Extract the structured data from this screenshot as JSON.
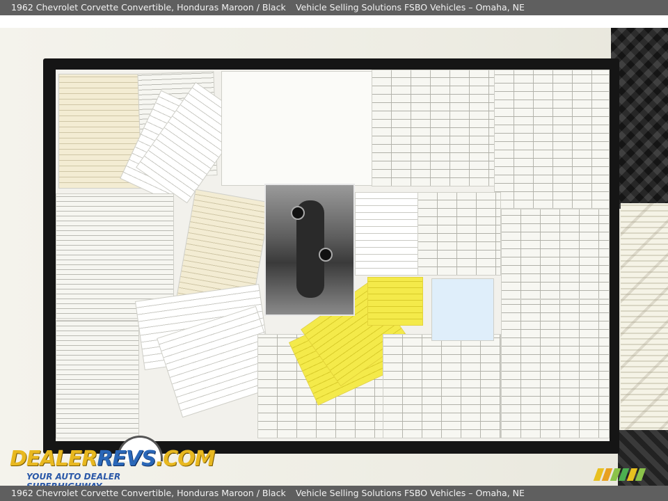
{
  "header": {
    "left": "1962 Chevrolet Corvette Convertible,  Honduras Maroon / Black",
    "right": "Vehicle Selling Solutions FSBO Vehicles – Omaha, NE"
  },
  "footer": {
    "left": "1962 Chevrolet Corvette Convertible,  Honduras Maroon / Black",
    "right": "Vehicle Selling Solutions FSBO Vehicles – Omaha, NE"
  },
  "watermark": {
    "logo_part1": "DEALER",
    "logo_part2": "REVS",
    "logo_part3": ".COM",
    "tagline": "YOUR AUTO DEALER SUPERHIGHWAY"
  },
  "colors": {
    "bar": "#5f5f5f",
    "logo_yellow": "#e8b820",
    "logo_blue": "#2a67b8",
    "stripes": [
      "#e8c020",
      "#e8a020",
      "#8bc34a",
      "#4caf50",
      "#e8c020",
      "#8bc34a"
    ]
  }
}
